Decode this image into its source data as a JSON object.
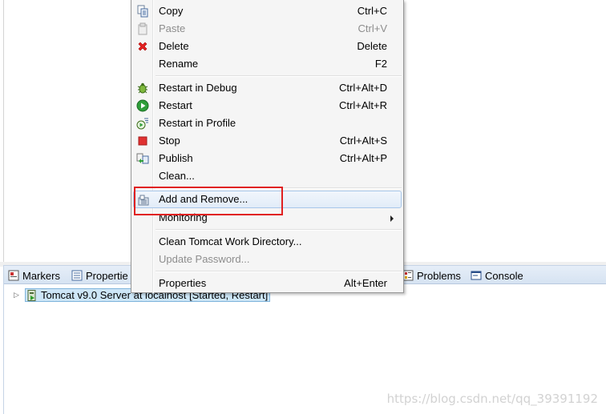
{
  "menu": {
    "items": [
      {
        "label": "Copy",
        "shortcut": "Ctrl+C",
        "icon": "copy-icon",
        "enabled": true
      },
      {
        "label": "Paste",
        "shortcut": "Ctrl+V",
        "icon": "paste-icon",
        "enabled": false
      },
      {
        "label": "Delete",
        "shortcut": "Delete",
        "icon": "delete-icon",
        "enabled": true
      },
      {
        "label": "Rename",
        "shortcut": "F2",
        "icon": "",
        "enabled": true
      },
      {
        "label": "Restart in Debug",
        "shortcut": "Ctrl+Alt+D",
        "icon": "debug-icon",
        "enabled": true
      },
      {
        "label": "Restart",
        "shortcut": "Ctrl+Alt+R",
        "icon": "run-icon",
        "enabled": true
      },
      {
        "label": "Restart in Profile",
        "shortcut": "",
        "icon": "profile-icon",
        "enabled": true
      },
      {
        "label": "Stop",
        "shortcut": "Ctrl+Alt+S",
        "icon": "stop-icon",
        "enabled": true
      },
      {
        "label": "Publish",
        "shortcut": "Ctrl+Alt+P",
        "icon": "publish-icon",
        "enabled": true
      },
      {
        "label": "Clean...",
        "shortcut": "",
        "icon": "",
        "enabled": true
      },
      {
        "label": "Add and Remove...",
        "shortcut": "",
        "icon": "add-remove-icon",
        "enabled": true
      },
      {
        "label": "Monitoring",
        "shortcut": "",
        "icon": "",
        "enabled": true
      },
      {
        "label": "Clean Tomcat Work Directory...",
        "shortcut": "",
        "icon": "",
        "enabled": true
      },
      {
        "label": "Update Password...",
        "shortcut": "",
        "icon": "",
        "enabled": false
      },
      {
        "label": "Properties",
        "shortcut": "Alt+Enter",
        "icon": "",
        "enabled": true
      }
    ]
  },
  "tabs": {
    "markers": "Markers",
    "properties": "Propertie",
    "problems": "Problems",
    "console": "Console"
  },
  "servers": {
    "row_label": "Tomcat v9.0 Server at localhost  [Started, Restart]"
  },
  "watermark": "https://blog.csdn.net/qq_39391192",
  "colors": {
    "highlight_box": "#e02020",
    "menu_hover": "#e2ecf8",
    "tab_bar": "#d6e3f2"
  }
}
